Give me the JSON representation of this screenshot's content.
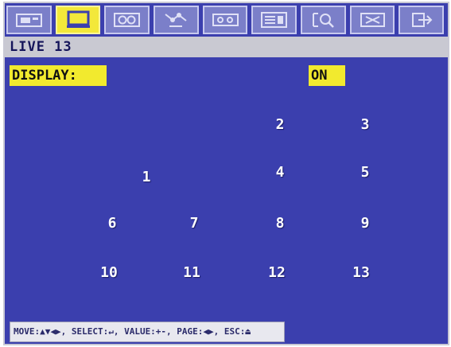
{
  "toolbar": {
    "tabs": [
      {
        "icon": "camera-settings-icon",
        "active": false
      },
      {
        "icon": "monitor-display-icon",
        "active": true
      },
      {
        "icon": "record-icon",
        "active": false
      },
      {
        "icon": "network-icon",
        "active": false
      },
      {
        "icon": "device-icon",
        "active": false
      },
      {
        "icon": "system-icon",
        "active": false
      },
      {
        "icon": "search-icon",
        "active": false
      },
      {
        "icon": "tools-icon",
        "active": false
      },
      {
        "icon": "exit-icon",
        "active": false
      }
    ]
  },
  "title": "LIVE 13",
  "display": {
    "label": "DISPLAY:",
    "value": "ON"
  },
  "channels": [
    {
      "label": "1"
    },
    {
      "label": "2"
    },
    {
      "label": "3"
    },
    {
      "label": "4"
    },
    {
      "label": "5"
    },
    {
      "label": "6"
    },
    {
      "label": "7"
    },
    {
      "label": "8"
    },
    {
      "label": "9"
    },
    {
      "label": "10"
    },
    {
      "label": "11"
    },
    {
      "label": "12"
    },
    {
      "label": "13"
    }
  ],
  "help": "MOVE:▲▼◀▶, SELECT:↵, VALUE:+-, PAGE:◀▶, ESC:⏏",
  "colors": {
    "background": "#3b3fae",
    "highlight": "#f2ea2e",
    "title_bar": "#c9c9d2"
  }
}
